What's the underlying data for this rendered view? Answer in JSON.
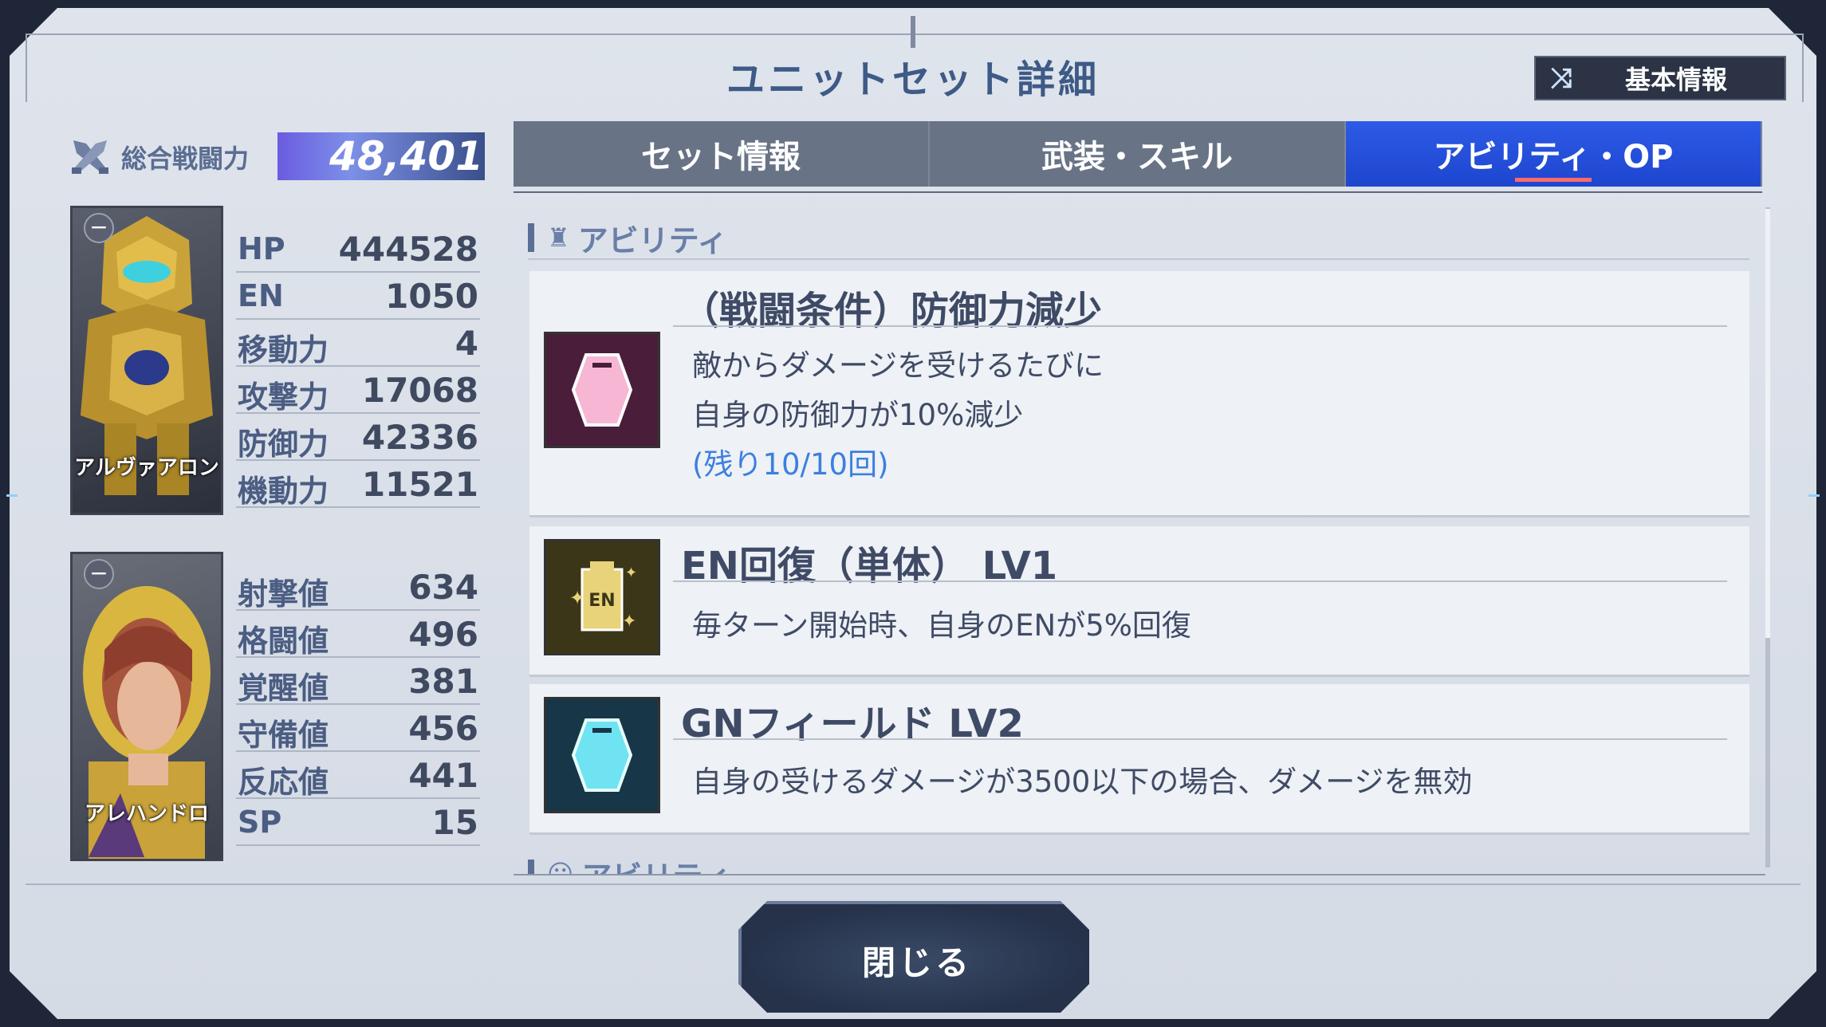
{
  "header": {
    "title": "ユニットセット詳細",
    "basic_info_button": "基本情報",
    "basic_info_icon": "shuffle-icon"
  },
  "power": {
    "label": "総合戦闘力",
    "value": "48,401",
    "icon": "crossed-swords-icon"
  },
  "unit": {
    "name": "アルヴァアロン",
    "stats": [
      {
        "label": "HP",
        "value": "444528"
      },
      {
        "label": "EN",
        "value": "1050"
      },
      {
        "label": "移動力",
        "value": "4"
      },
      {
        "label": "攻撃力",
        "value": "17068"
      },
      {
        "label": "防御力",
        "value": "42336"
      },
      {
        "label": "機動力",
        "value": "11521"
      }
    ]
  },
  "pilot": {
    "name": "アレハンドロ",
    "stats": [
      {
        "label": "射撃値",
        "value": "634"
      },
      {
        "label": "格闘値",
        "value": "496"
      },
      {
        "label": "覚醒値",
        "value": "381"
      },
      {
        "label": "守備値",
        "value": "456"
      },
      {
        "label": "反応値",
        "value": "441"
      },
      {
        "label": "SP",
        "value": "15"
      }
    ]
  },
  "tabs": [
    {
      "label": "セット情報",
      "active": false
    },
    {
      "label": "武装・スキル",
      "active": false
    },
    {
      "label": "アビリティ・OP",
      "active": true
    }
  ],
  "abilities_section": {
    "heading": "アビリティ",
    "icon": "mecha-head-icon",
    "items": [
      {
        "title": "（戦闘条件）防御力減少",
        "desc1": "敵からダメージを受けるたびに",
        "desc2": "自身の防御力が10%減少",
        "remaining": "(残り10/10回)",
        "icon": "shield-pink-icon",
        "color": "#f6b6d4"
      },
      {
        "title": "EN回復（単体） LV1",
        "desc1": "毎ターン開始時、自身のENが5%回復",
        "icon": "en-tank-icon",
        "icon_text": "EN",
        "color": "#e8d37a"
      },
      {
        "title": "GNフィールド LV2",
        "desc1": "自身の受けるダメージが3500以下の場合、ダメージを無効",
        "icon": "shield-cyan-icon",
        "color": "#6fe3f2"
      }
    ]
  },
  "pilot_section": {
    "heading": "アビリティ",
    "icon": "pilot-head-icon"
  },
  "footer": {
    "close_button": "閉じる"
  }
}
